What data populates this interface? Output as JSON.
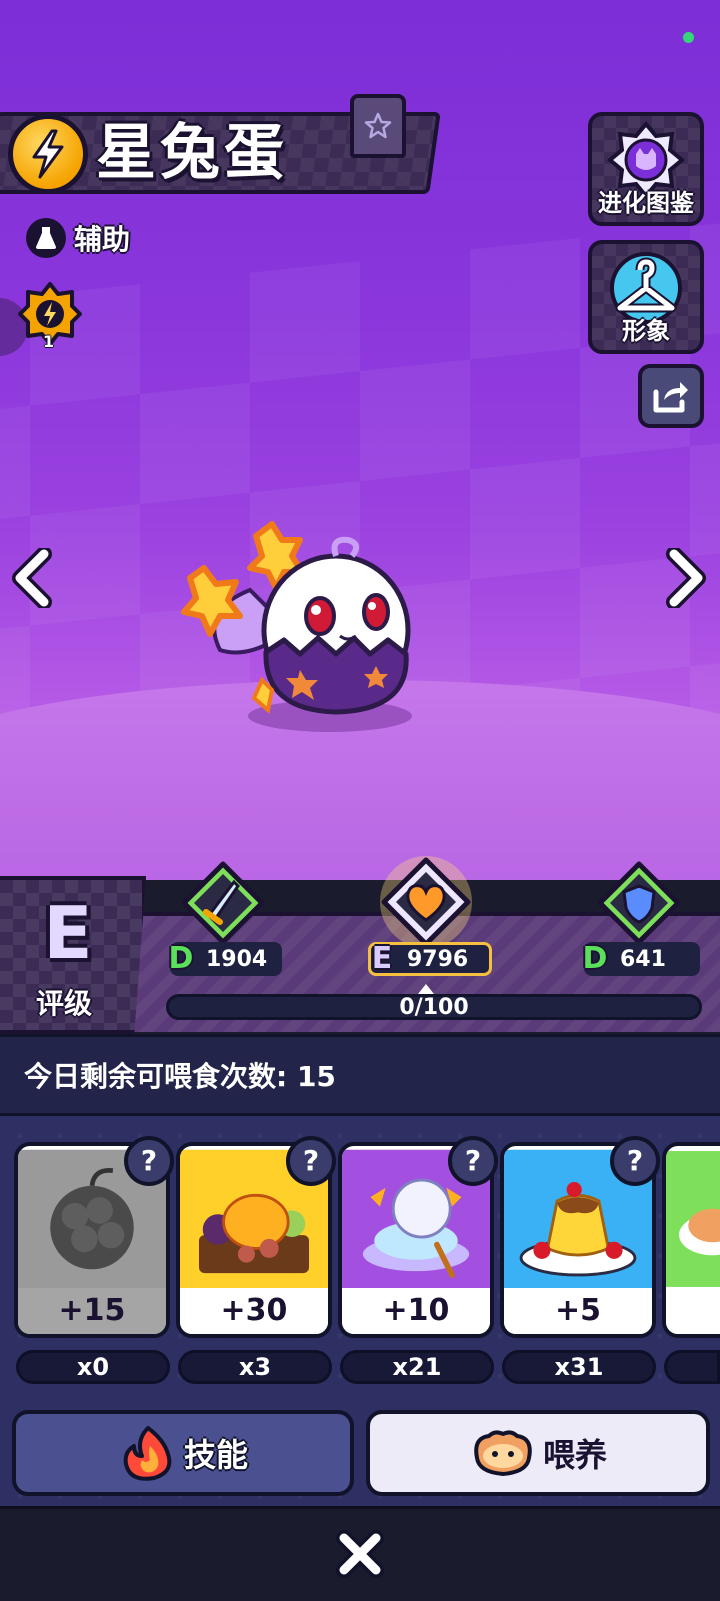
{
  "pet": {
    "name": "星兔蛋",
    "role": "辅助",
    "rank_level": "1"
  },
  "side_buttons": {
    "evolution": "进化图鉴",
    "appearance": "形象"
  },
  "grade": {
    "letter": "E",
    "label": "评级"
  },
  "stats": [
    {
      "name": "attack",
      "tier": "D",
      "value": "1904",
      "tier_color": "#5be05b"
    },
    {
      "name": "hp",
      "tier": "E",
      "value": "9796",
      "tier_color": "#d9ccff"
    },
    {
      "name": "defense",
      "tier": "D",
      "value": "641",
      "tier_color": "#5be05b"
    }
  ],
  "progress": {
    "text": "0/100",
    "fraction": 0
  },
  "feed": {
    "remaining_text": "今日剩余可喂食次数: 15"
  },
  "foods": [
    {
      "name": "dark-berry",
      "bonus": "+15",
      "qty": "x0",
      "help": "?"
    },
    {
      "name": "bento-meal",
      "bonus": "+30",
      "qty": "x3",
      "help": "?"
    },
    {
      "name": "ice-cream-dessert",
      "bonus": "+10",
      "qty": "x21",
      "help": "?"
    },
    {
      "name": "pudding",
      "bonus": "+5",
      "qty": "x31",
      "help": "?"
    }
  ],
  "actions": {
    "skill": "技能",
    "feed": "喂养"
  },
  "colors": {
    "accent_purple": "#7d2ed6",
    "gold": "#f5a300",
    "tier_green": "#5be05b"
  }
}
